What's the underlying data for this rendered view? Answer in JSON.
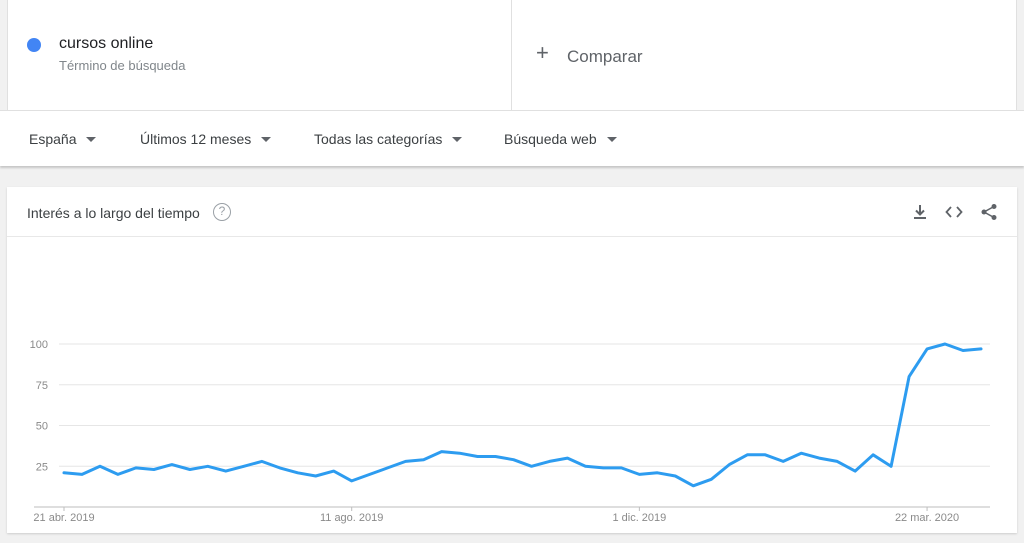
{
  "term": {
    "name": "cursos online",
    "subtitle": "Término de búsqueda",
    "color": "#4285f4"
  },
  "compare": {
    "label": "Comparar"
  },
  "filters": [
    {
      "label": "España"
    },
    {
      "label": "Últimos 12 meses"
    },
    {
      "label": "Todas las categorías"
    },
    {
      "label": "Búsqueda web"
    }
  ],
  "chart_header": {
    "title": "Interés a lo largo del tiempo",
    "help": "?"
  },
  "icons": {
    "download": "download-icon",
    "embed": "embed-code-icon",
    "share": "share-icon"
  },
  "chart_data": {
    "type": "line",
    "title": "Interés a lo largo del tiempo",
    "xlabel": "",
    "ylabel": "",
    "ylim": [
      0,
      100
    ],
    "yticks": [
      25,
      50,
      75,
      100
    ],
    "xticks": [
      {
        "label": "21 abr. 2019",
        "index": 0
      },
      {
        "label": "11 ago. 2019",
        "index": 16
      },
      {
        "label": "1 dic. 2019",
        "index": 32
      },
      {
        "label": "22 mar. 2020",
        "index": 48
      }
    ],
    "grid": true,
    "line_color": "#2d9cf0",
    "series": [
      {
        "name": "cursos online",
        "values": [
          21,
          20,
          25,
          20,
          24,
          23,
          26,
          23,
          25,
          22,
          25,
          28,
          24,
          21,
          19,
          22,
          16,
          20,
          24,
          28,
          29,
          34,
          33,
          31,
          31,
          29,
          25,
          28,
          30,
          25,
          24,
          24,
          20,
          21,
          19,
          13,
          17,
          26,
          32,
          32,
          28,
          33,
          30,
          28,
          22,
          32,
          25,
          80,
          97,
          100,
          96,
          97
        ]
      }
    ]
  }
}
